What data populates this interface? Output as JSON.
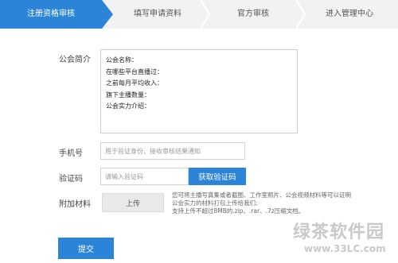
{
  "steps": [
    {
      "label": "注册资格审核"
    },
    {
      "label": "填写申请资料"
    },
    {
      "label": "官方审核"
    },
    {
      "label": "进入管理中心"
    }
  ],
  "form": {
    "intro_label": "公会简介",
    "intro_lines": [
      "公会名称：",
      "在哪些平台直播过：",
      "之前每月平均收入：",
      "旗下主播数量：",
      "公会实力介绍："
    ],
    "phone_label": "手机号",
    "phone_placeholder": "用于验证身份、接收审核结果通知",
    "code_label": "验证码",
    "code_placeholder": "请输入验证码",
    "get_code_button": "获取验证码",
    "attach_label": "附加材料",
    "upload_button": "上传",
    "hint_lines": [
      "您可将主播写真集或者截图、工作室照片、公会视频材料等可以证明",
      "公会实力的材料打包上传给我们;",
      "支持上传不超过8MB的.zip、.rar、.7z压缩文档。"
    ],
    "submit_button": "提交"
  },
  "watermark": {
    "text": "绿茶软件园",
    "url": "www.33LC.com"
  },
  "colors": {
    "accent": "#2b84d8",
    "step_bar_bg": "#f2f2f2"
  }
}
